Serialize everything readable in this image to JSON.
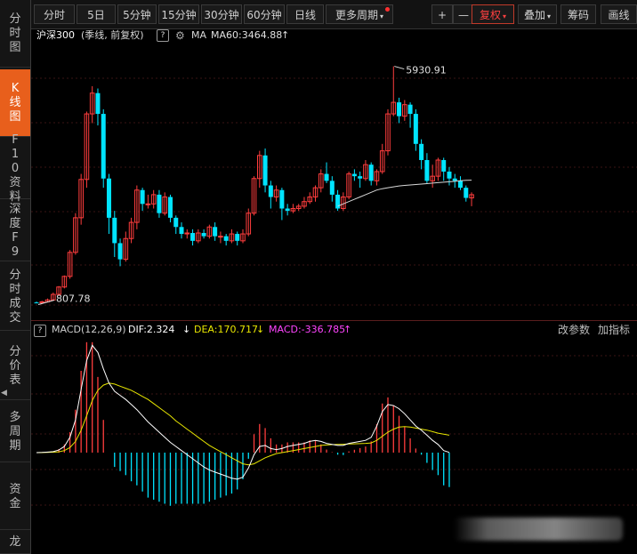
{
  "sidebar": {
    "items": [
      {
        "label": "分时图",
        "active": false
      },
      {
        "label": "K线图",
        "active": true
      },
      {
        "label": "F10资料",
        "active": false
      },
      {
        "label": "深度F9",
        "active": false
      },
      {
        "label": "分时成交",
        "active": false
      },
      {
        "label": "分价表",
        "active": false
      },
      {
        "label": "多周期",
        "active": false
      },
      {
        "label": "资金",
        "active": false
      },
      {
        "label": "龙",
        "active": false
      }
    ]
  },
  "toolbar": {
    "periods": [
      "分时",
      "5日",
      "5分钟",
      "15分钟",
      "30分钟",
      "60分钟",
      "日线",
      "更多周期"
    ],
    "plus": "+",
    "minus": "—",
    "fuquan": "复权",
    "diejia": "叠加",
    "chouma": "筹码",
    "huaxian": "画线"
  },
  "info": {
    "name": "沪深300",
    "mode": "(季线, 前复权)",
    "ma_label": "MA",
    "ma60": "MA60:3464.88",
    "ma60_arrow": "↑"
  },
  "macd": {
    "label": "MACD(12,26,9)",
    "dif": "DIF:2.324",
    "dif_arrow": "↓",
    "dea": "DEA:170.717",
    "dea_arrow": "↓",
    "macd": "MACD:-336.785",
    "macd_arrow": "↑",
    "change_params": "改参数",
    "add_indicator": "加指标"
  },
  "annotations": {
    "high": "5930.91",
    "low": "807.78"
  },
  "colors": {
    "up": "#ff3d3d",
    "down": "#00e4ff",
    "ma60": "#d8d8d8",
    "dif": "#ffffff",
    "dea": "#e8e600",
    "macd_text": "#ff44ff",
    "active_tab": "#e85f1c"
  },
  "chart_data": {
    "type": "candlestick",
    "period": "季线",
    "high_label": 5930.91,
    "low_label": 807.78,
    "candles": [
      [
        815,
        810,
        835,
        807.78
      ],
      [
        810,
        830,
        850,
        800
      ],
      [
        830,
        870,
        900,
        815
      ],
      [
        870,
        990,
        1030,
        855
      ],
      [
        990,
        1150,
        1170,
        960
      ],
      [
        1150,
        1380,
        1400,
        1120
      ],
      [
        1380,
        1900,
        1950,
        1330
      ],
      [
        1900,
        2650,
        2750,
        1850
      ],
      [
        2650,
        3480,
        3600,
        2500
      ],
      [
        3480,
        4900,
        4950,
        3300
      ],
      [
        4900,
        5350,
        5500,
        4700
      ],
      [
        5350,
        4900,
        5450,
        4650
      ],
      [
        4900,
        3500,
        5000,
        3300
      ],
      [
        3500,
        2650,
        3600,
        2300
      ],
      [
        2650,
        2100,
        2800,
        1800
      ],
      [
        2100,
        1750,
        2200,
        1600
      ],
      [
        1750,
        2200,
        2350,
        1700
      ],
      [
        2200,
        2550,
        2650,
        2100
      ],
      [
        2550,
        3250,
        3350,
        2400
      ],
      [
        3250,
        2950,
        3300,
        2800
      ],
      [
        2950,
        2950,
        3150,
        2850
      ],
      [
        2950,
        3150,
        3250,
        2850
      ],
      [
        3150,
        2750,
        3250,
        2650
      ],
      [
        2750,
        3100,
        3200,
        2700
      ],
      [
        3100,
        2650,
        3150,
        2550
      ],
      [
        2650,
        2450,
        2700,
        2300
      ],
      [
        2450,
        2300,
        2550,
        2200
      ],
      [
        2300,
        2320,
        2400,
        2200
      ],
      [
        2320,
        2150,
        2400,
        2050
      ],
      [
        2150,
        2320,
        2400,
        2100
      ],
      [
        2320,
        2250,
        2400,
        2200
      ],
      [
        2250,
        2450,
        2500,
        2200
      ],
      [
        2450,
        2250,
        2550,
        2150
      ],
      [
        2250,
        2250,
        2350,
        2100
      ],
      [
        2250,
        2150,
        2300,
        2050
      ],
      [
        2150,
        2300,
        2400,
        2100
      ],
      [
        2300,
        2150,
        2350,
        2050
      ],
      [
        2150,
        2300,
        2400,
        2100
      ],
      [
        2300,
        2750,
        2850,
        2250
      ],
      [
        2750,
        3500,
        3550,
        2700
      ],
      [
        3500,
        4000,
        4100,
        3300
      ],
      [
        4000,
        3350,
        4150,
        3200
      ],
      [
        3350,
        3100,
        3450,
        2850
      ],
      [
        3100,
        3250,
        3350,
        3000
      ],
      [
        3250,
        2850,
        3300,
        2600
      ],
      [
        2850,
        2800,
        2950,
        2700
      ],
      [
        2800,
        2850,
        2950,
        2750
      ],
      [
        2850,
        2900,
        2950,
        2800
      ],
      [
        2900,
        3000,
        3100,
        2850
      ],
      [
        3000,
        3100,
        3200,
        2950
      ],
      [
        3100,
        3300,
        3350,
        3000
      ],
      [
        3300,
        3600,
        3700,
        3200
      ],
      [
        3600,
        3450,
        3850,
        3400
      ],
      [
        3450,
        3150,
        3550,
        3000
      ],
      [
        3150,
        2850,
        3250,
        2800
      ],
      [
        2850,
        3100,
        3200,
        2800
      ],
      [
        3100,
        3600,
        3650,
        3050
      ],
      [
        3600,
        3550,
        3700,
        3450
      ],
      [
        3550,
        3500,
        3650,
        3300
      ],
      [
        3500,
        3800,
        3900,
        3450
      ],
      [
        3800,
        3450,
        3850,
        3350
      ],
      [
        3450,
        3650,
        3700,
        3350
      ],
      [
        3650,
        4100,
        4250,
        3600
      ],
      [
        4100,
        4900,
        5000,
        4000
      ],
      [
        4900,
        5150,
        5930.91,
        4850
      ],
      [
        5150,
        4850,
        5250,
        4700
      ],
      [
        4850,
        5100,
        5200,
        4750
      ],
      [
        5100,
        4900,
        5150,
        4600
      ],
      [
        4900,
        4250,
        5000,
        4100
      ],
      [
        4250,
        3900,
        4350,
        3700
      ],
      [
        3900,
        3450,
        4050,
        3400
      ],
      [
        3450,
        3550,
        3800,
        3300
      ],
      [
        3550,
        3900,
        3950,
        3450
      ],
      [
        3900,
        3650,
        3950,
        3450
      ],
      [
        3650,
        3500,
        3750,
        3350
      ],
      [
        3500,
        3450,
        3600,
        3300
      ],
      [
        3450,
        3300,
        3550,
        3250
      ],
      [
        3300,
        3080,
        3350,
        3000
      ],
      [
        3080,
        3150,
        3200,
        2900
      ]
    ],
    "ma60_series": [
      2900,
      2950,
      3000,
      3050,
      3100,
      3150,
      3200,
      3250,
      3280,
      3300,
      3320,
      3340,
      3350,
      3360,
      3370,
      3380,
      3390,
      3400,
      3410,
      3420,
      3430,
      3440,
      3450,
      3460,
      3464.88
    ],
    "macd": {
      "dif": [
        0,
        2,
        5,
        10,
        25,
        60,
        150,
        320,
        620,
        900,
        1050,
        980,
        820,
        680,
        600,
        560,
        520,
        470,
        420,
        360,
        300,
        250,
        200,
        150,
        100,
        60,
        20,
        -20,
        -60,
        -100,
        -140,
        -170,
        -190,
        -210,
        -230,
        -250,
        -260,
        -240,
        -150,
        -20,
        60,
        70,
        40,
        30,
        40,
        60,
        70,
        80,
        90,
        110,
        120,
        110,
        90,
        80,
        70,
        70,
        90,
        100,
        110,
        120,
        150,
        260,
        400,
        470,
        460,
        430,
        380,
        320,
        260,
        220,
        170,
        120,
        80,
        20,
        2.324
      ],
      "dea": [
        0,
        1,
        2,
        4,
        8,
        20,
        50,
        110,
        220,
        360,
        510,
        610,
        660,
        680,
        670,
        650,
        630,
        610,
        580,
        550,
        520,
        480,
        440,
        400,
        360,
        310,
        270,
        230,
        190,
        150,
        110,
        70,
        40,
        10,
        -20,
        -50,
        -80,
        -110,
        -120,
        -110,
        -80,
        -50,
        -30,
        -10,
        0,
        10,
        20,
        30,
        40,
        50,
        60,
        70,
        75,
        78,
        80,
        82,
        84,
        86,
        88,
        90,
        95,
        120,
        160,
        200,
        230,
        250,
        255,
        250,
        240,
        230,
        220,
        205,
        190,
        180,
        170.717
      ],
      "hist": [
        0,
        2,
        6,
        12,
        34,
        80,
        200,
        420,
        800,
        1080,
        1080,
        740,
        320,
        0,
        -140,
        -180,
        -220,
        -280,
        -320,
        -380,
        -440,
        -460,
        -480,
        -500,
        -520,
        -500,
        -500,
        -500,
        -500,
        -500,
        -500,
        -480,
        -460,
        -440,
        -420,
        -400,
        -360,
        -260,
        -60,
        180,
        280,
        240,
        140,
        80,
        80,
        100,
        100,
        100,
        100,
        120,
        120,
        80,
        30,
        4,
        -20,
        -24,
        12,
        28,
        44,
        60,
        110,
        280,
        480,
        540,
        460,
        360,
        250,
        140,
        40,
        -20,
        -100,
        -170,
        -220,
        -320,
        -336.785
      ]
    }
  }
}
